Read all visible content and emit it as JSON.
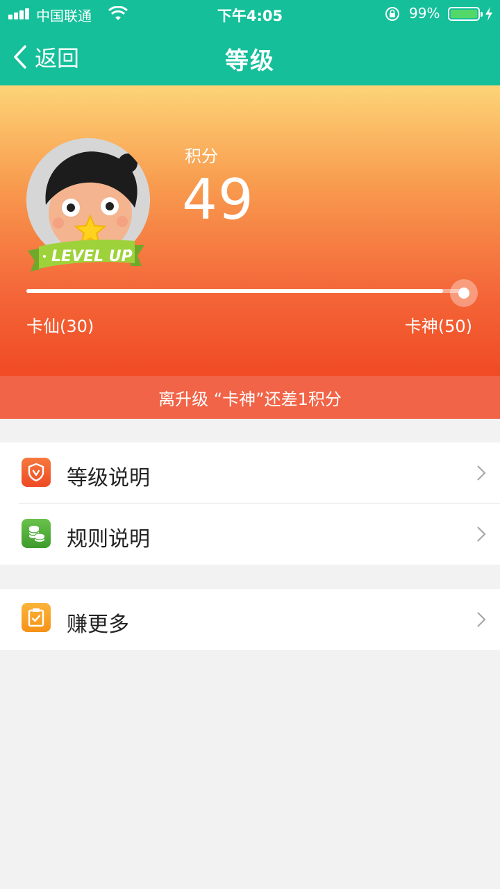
{
  "status_bar": {
    "carrier": "中国联通",
    "time": "下午4:05",
    "battery_percent": "99%",
    "battery_level": 0.99,
    "battery_color": "#53d769"
  },
  "nav": {
    "back_label": "返回",
    "title": "等级",
    "bar_color": "#14bf9a"
  },
  "profile": {
    "avatar_badge_text": "LEVEL UP",
    "points_label": "积分",
    "points_value": "49"
  },
  "progress": {
    "current_level": "卡仙(30)",
    "next_level": "卡神(50)",
    "fraction": 0.95
  },
  "notice": {
    "text": "离升级 “卡神”还差1积分",
    "color": "#f16447"
  },
  "menu": {
    "items": [
      {
        "label": "等级说明",
        "icon": "shield-v-icon",
        "color": "#f05a2b"
      },
      {
        "label": "规则说明",
        "icon": "coins-icon",
        "color": "#4caf3c"
      },
      {
        "label": "赚更多",
        "icon": "clipboard-check-icon",
        "color": "#f6a623"
      }
    ]
  }
}
